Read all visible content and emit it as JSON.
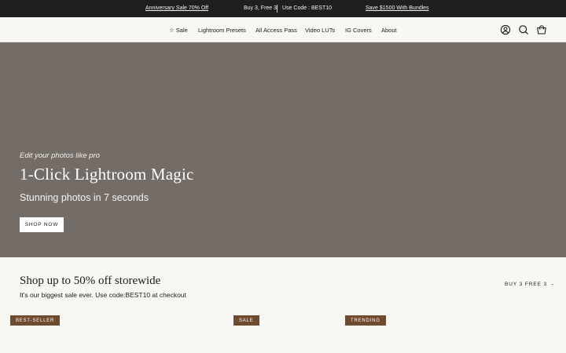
{
  "announcement": {
    "promo_1": "Anniversary Sale 70% Off",
    "promo_2": "Buy 3, Free 3",
    "promo_3": "Use Code : BEST10",
    "promo_4": "Save $1500 With Bundles"
  },
  "nav": {
    "items": [
      {
        "label": "☆ Sale"
      },
      {
        "label": "Lightroom Presets"
      },
      {
        "label": "All Access Pass"
      },
      {
        "label": "Video LUTs"
      },
      {
        "label": "IG Covers"
      },
      {
        "label": "About"
      }
    ],
    "icons": [
      "account-icon",
      "search-icon",
      "cart-icon"
    ]
  },
  "hero": {
    "kicker": "Edit your photos like pro",
    "title": "1-Click Lightroom Magic",
    "subtitle": "Stunning photos in 7 seconds",
    "cta_label": "SHOP NOW",
    "background_color": "#736c67"
  },
  "sale_section": {
    "title": "Shop up to 50% off storewide",
    "subtitle_prefix": "It's our biggest sale ever. Use code:",
    "code": "BEST10",
    "subtitle_suffix": " at checkout",
    "link_label": "BUY 3 FREE 3 →",
    "badges": [
      "BEST-SELLER",
      "SALE",
      "TRENDING"
    ],
    "badge_color": "#6e4a2f"
  }
}
